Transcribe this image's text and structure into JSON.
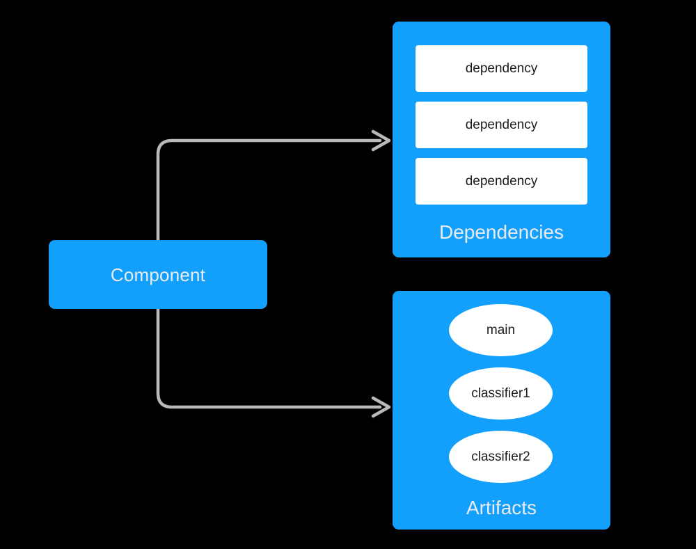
{
  "diagram": {
    "background_color": "#000000",
    "accent_color": "#139ffc",
    "node_label_color": "#e9ecef",
    "connector_color": "#b9b9b9",
    "component": {
      "title": "Component"
    },
    "dependencies_group": {
      "label": "Dependencies",
      "items": [
        {
          "label": "dependency"
        },
        {
          "label": "dependency"
        },
        {
          "label": "dependency"
        }
      ]
    },
    "artifacts_group": {
      "label": "Artifacts",
      "items": [
        {
          "label": "main"
        },
        {
          "label": "classifier1"
        },
        {
          "label": "classifier2"
        }
      ]
    },
    "connectors": [
      {
        "from": "Component",
        "to": "Dependencies",
        "arrow": "arrow-head-icon"
      },
      {
        "from": "Component",
        "to": "Artifacts",
        "arrow": "arrow-head-icon"
      }
    ]
  }
}
